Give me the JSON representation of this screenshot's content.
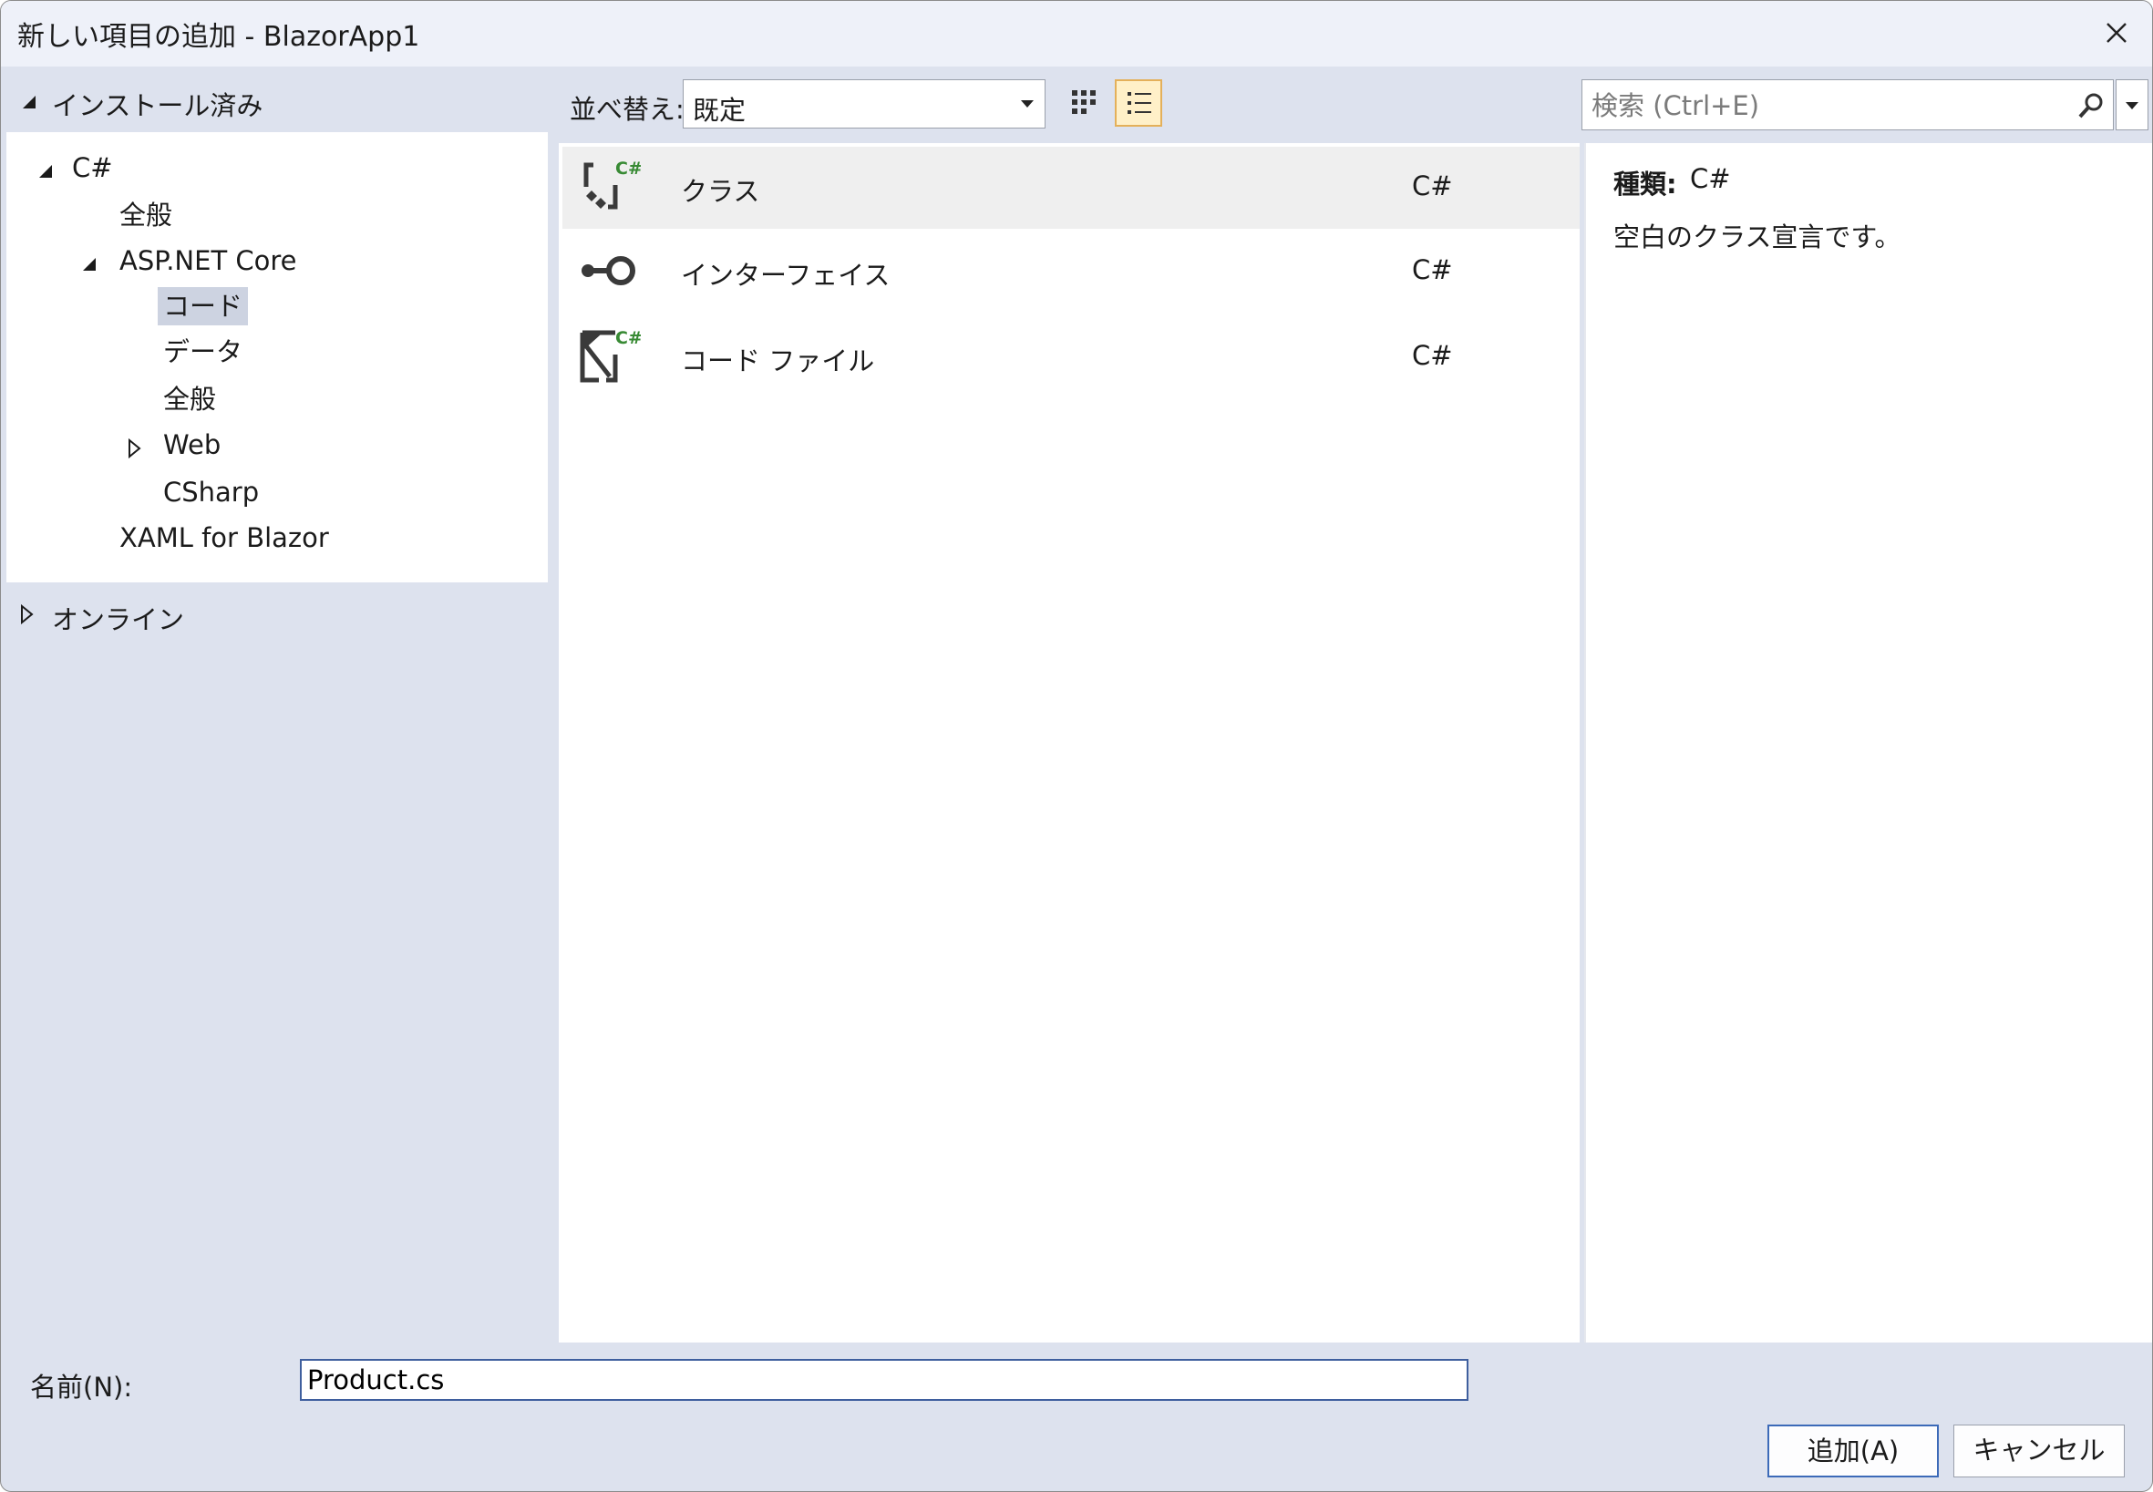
{
  "window": {
    "title": "新しい項目の追加 - BlazorApp1"
  },
  "left": {
    "installed_label": "インストール済み",
    "online_label": "オンライン",
    "tree": {
      "csharp": "C#",
      "general": "全般",
      "aspnet": "ASP.NET Core",
      "code": "コード",
      "data": "データ",
      "general2": "全般",
      "web": "Web",
      "csharp2": "CSharp",
      "xaml": "XAML for Blazor"
    }
  },
  "toolbar": {
    "sort_label": "並べ替え:",
    "sort_value": "既定",
    "search_placeholder": "検索 (Ctrl+E)"
  },
  "templates": [
    {
      "name": "クラス",
      "lang": "C#",
      "icon": "class-icon"
    },
    {
      "name": "インターフェイス",
      "lang": "C#",
      "icon": "interface-icon"
    },
    {
      "name": "コード ファイル",
      "lang": "C#",
      "icon": "code-file-icon"
    }
  ],
  "details": {
    "type_label": "種類:",
    "type_value": "C#",
    "description": "空白のクラス宣言です。"
  },
  "bottom": {
    "name_label": "名前(N):",
    "name_value": "Product.cs",
    "add_label": "追加(A)",
    "cancel_label": "キャンセル"
  },
  "colors": {
    "csharp_badge": "#388a34",
    "selected_view": "#fff0c8",
    "primary_border": "#3c6ab8"
  }
}
